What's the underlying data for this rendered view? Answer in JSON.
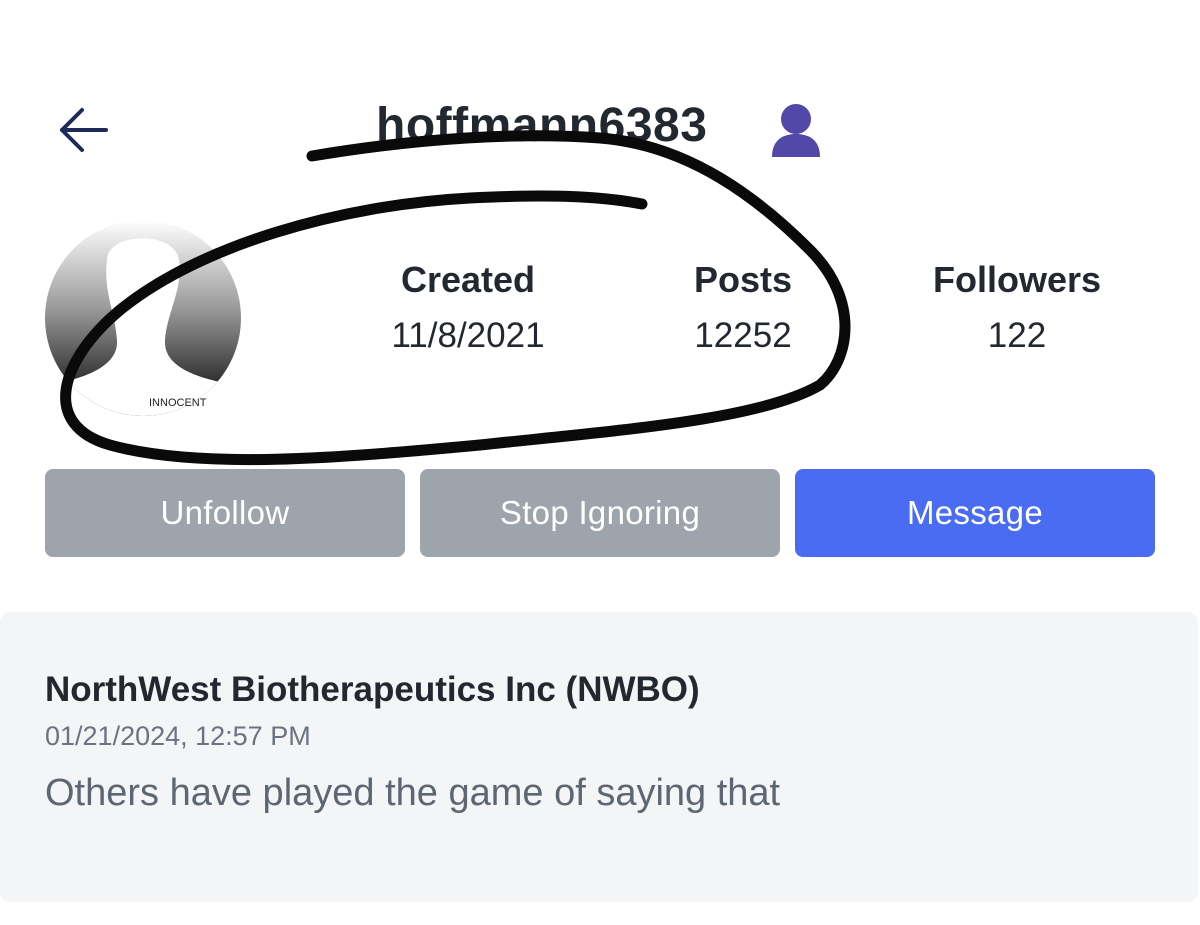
{
  "header": {
    "username": "hoffmann6383",
    "back_icon": "arrow-left-icon",
    "user_icon": "person-icon"
  },
  "profile": {
    "avatar_caption": "INNOCENT",
    "stats": [
      {
        "label": "Created",
        "value": "11/8/2021"
      },
      {
        "label": "Posts",
        "value": "12252"
      },
      {
        "label": "Followers",
        "value": "122"
      }
    ]
  },
  "actions": {
    "unfollow_label": "Unfollow",
    "stop_ignoring_label": "Stop Ignoring",
    "message_label": "Message"
  },
  "post": {
    "title": "NorthWest Biotherapeutics Inc (NWBO)",
    "date": "01/21/2024, 12:57 PM",
    "body": "Others have played the game of saying that"
  },
  "colors": {
    "text_dark": "#23272f",
    "button_gray": "#9ea4ac",
    "button_blue": "#4a6cf2",
    "icon_navy": "#1f2a5a",
    "icon_purple": "#5148a8",
    "card_bg": "#f4f5f7"
  }
}
